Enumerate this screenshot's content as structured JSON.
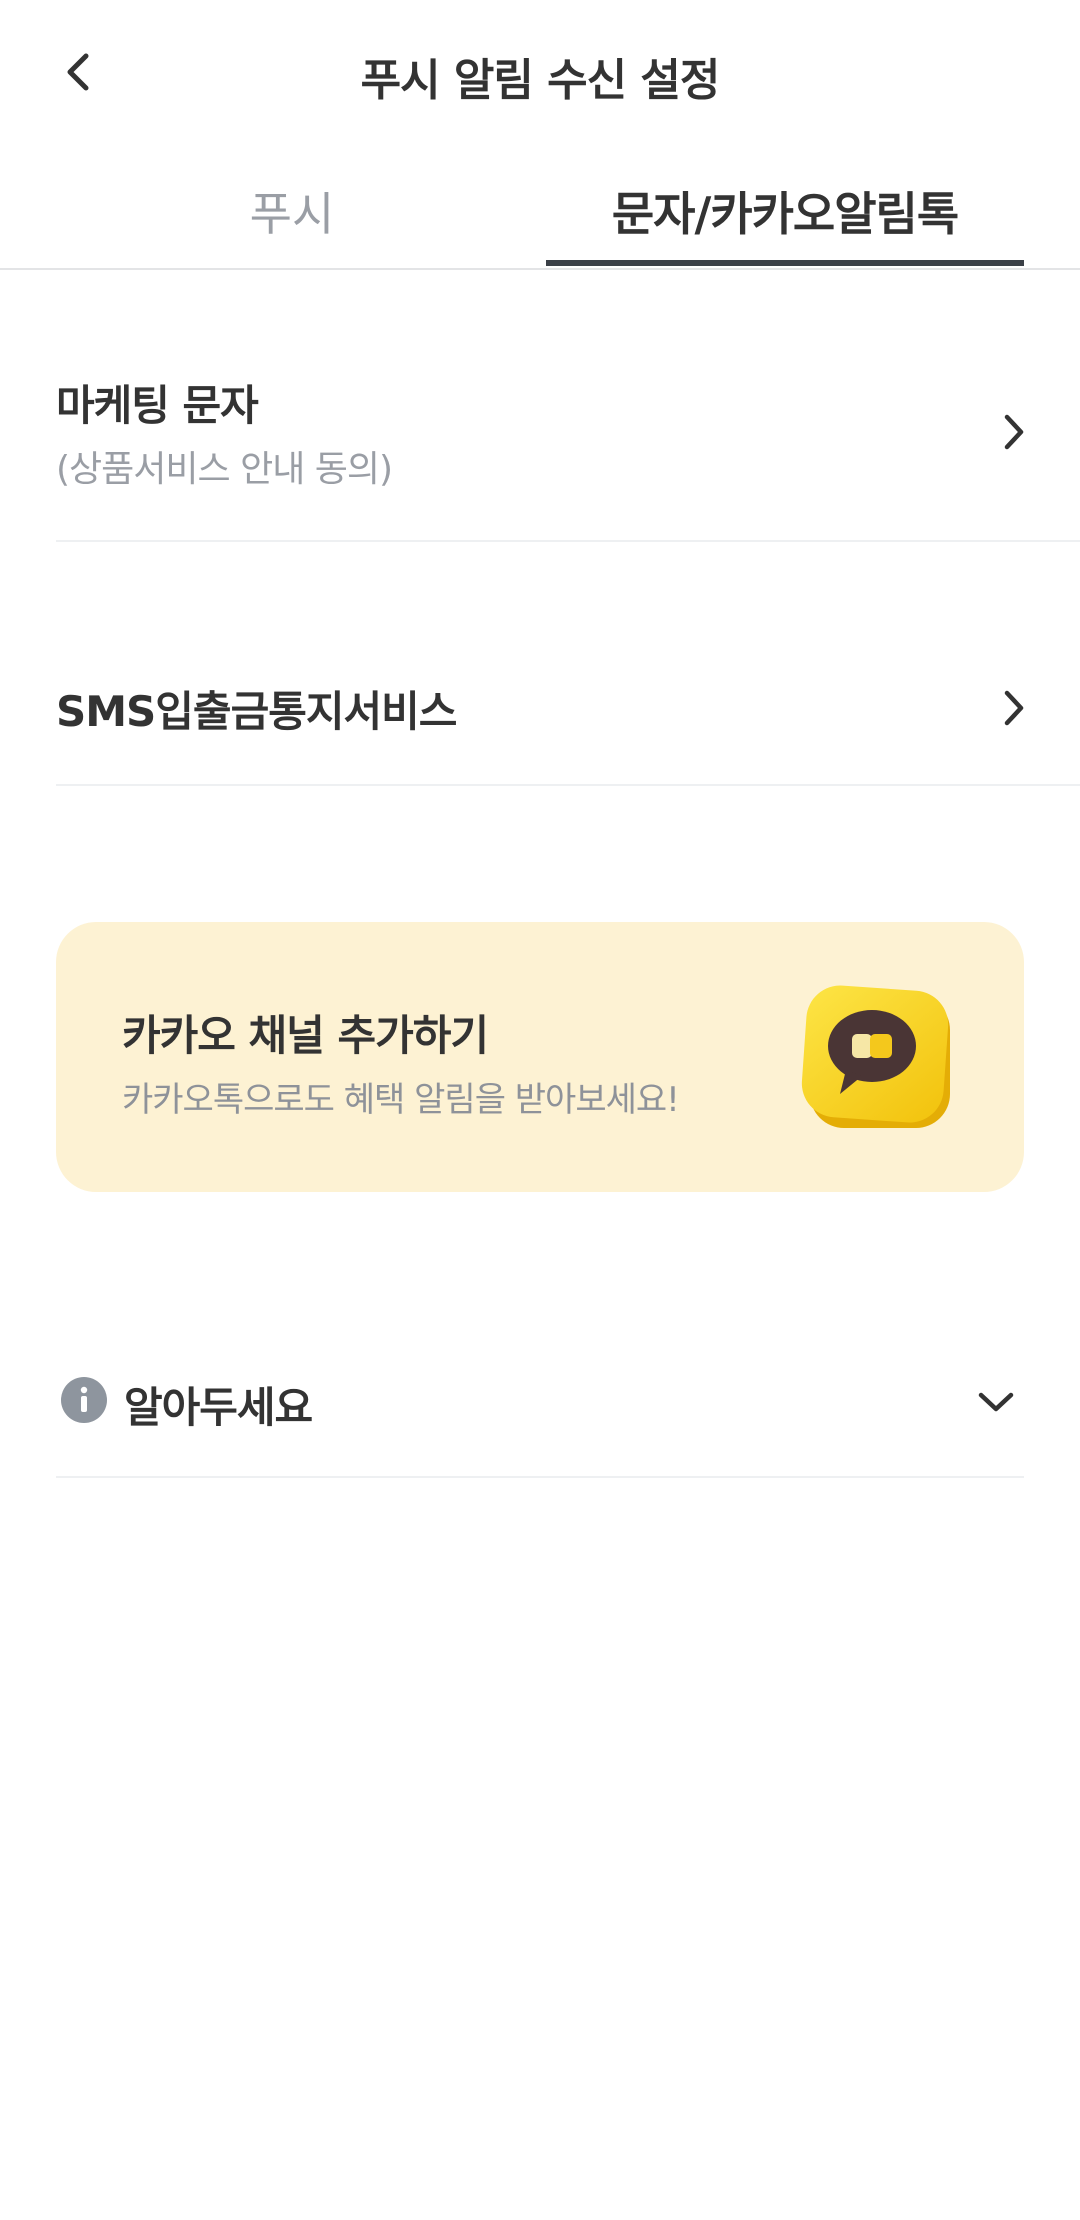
{
  "header": {
    "title": "푸시 알림 수신 설정",
    "back_icon": "chevron-left-icon"
  },
  "tabs": [
    {
      "label": "푸시",
      "selected": false
    },
    {
      "label": "문자/카카오알림톡",
      "selected": true
    }
  ],
  "settings": [
    {
      "title": "마케팅 문자",
      "subtitle": "(상품서비스 안내 동의)"
    },
    {
      "title": "SMS입출금통지서비스"
    }
  ],
  "kakao_banner": {
    "title": "카카오 채널 추가하기",
    "subtitle": "카카오톡으로도 혜택 알림을 받아보세요!",
    "icon": "kakao-channel-icon",
    "background": "#fdf2d3"
  },
  "notice": {
    "label": "알아두세요",
    "icon": "info-icon",
    "expanded": false
  },
  "colors": {
    "text_primary": "#333333",
    "text_secondary": "#9a9ea5",
    "tab_indicator": "#3b4047",
    "kakao_yellow": "#f9d21f"
  }
}
